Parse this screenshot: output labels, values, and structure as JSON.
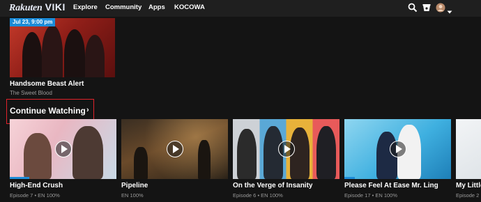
{
  "header": {
    "logo_part1": "Rakuten",
    "logo_part2": "VIKI",
    "nav": [
      "Explore",
      "Community",
      "Apps",
      "KOCOWA"
    ],
    "icons": [
      "search-icon",
      "cup-icon",
      "avatar",
      "chevron-down-icon"
    ]
  },
  "hero": {
    "badge": "Jul 23, 9:00 pm",
    "title": "Handsome Beast Alert",
    "subtitle": "The Sweet Blood"
  },
  "section": {
    "title": "Continue Watching",
    "chevron": "›",
    "highlight_color": "#e0232b"
  },
  "cards": [
    {
      "title": "High-End Crush",
      "meta": "Episode 7 • EN 100%",
      "progress": 0.18
    },
    {
      "title": "Pipeline",
      "meta": "EN 100%",
      "progress": 0.0
    },
    {
      "title": "On the Verge of Insanity",
      "meta": "Episode 6 • EN 100%",
      "progress": 0.0
    },
    {
      "title": "Please Feel At Ease Mr. Ling",
      "meta": "Episode 17 • EN 100%",
      "progress": 0.1
    },
    {
      "title": "My Little",
      "meta": "Episode 2",
      "progress": 0.0
    }
  ],
  "colors": {
    "accent": "#1c8cd8",
    "background": "#141414",
    "header": "#1f1f1f"
  }
}
